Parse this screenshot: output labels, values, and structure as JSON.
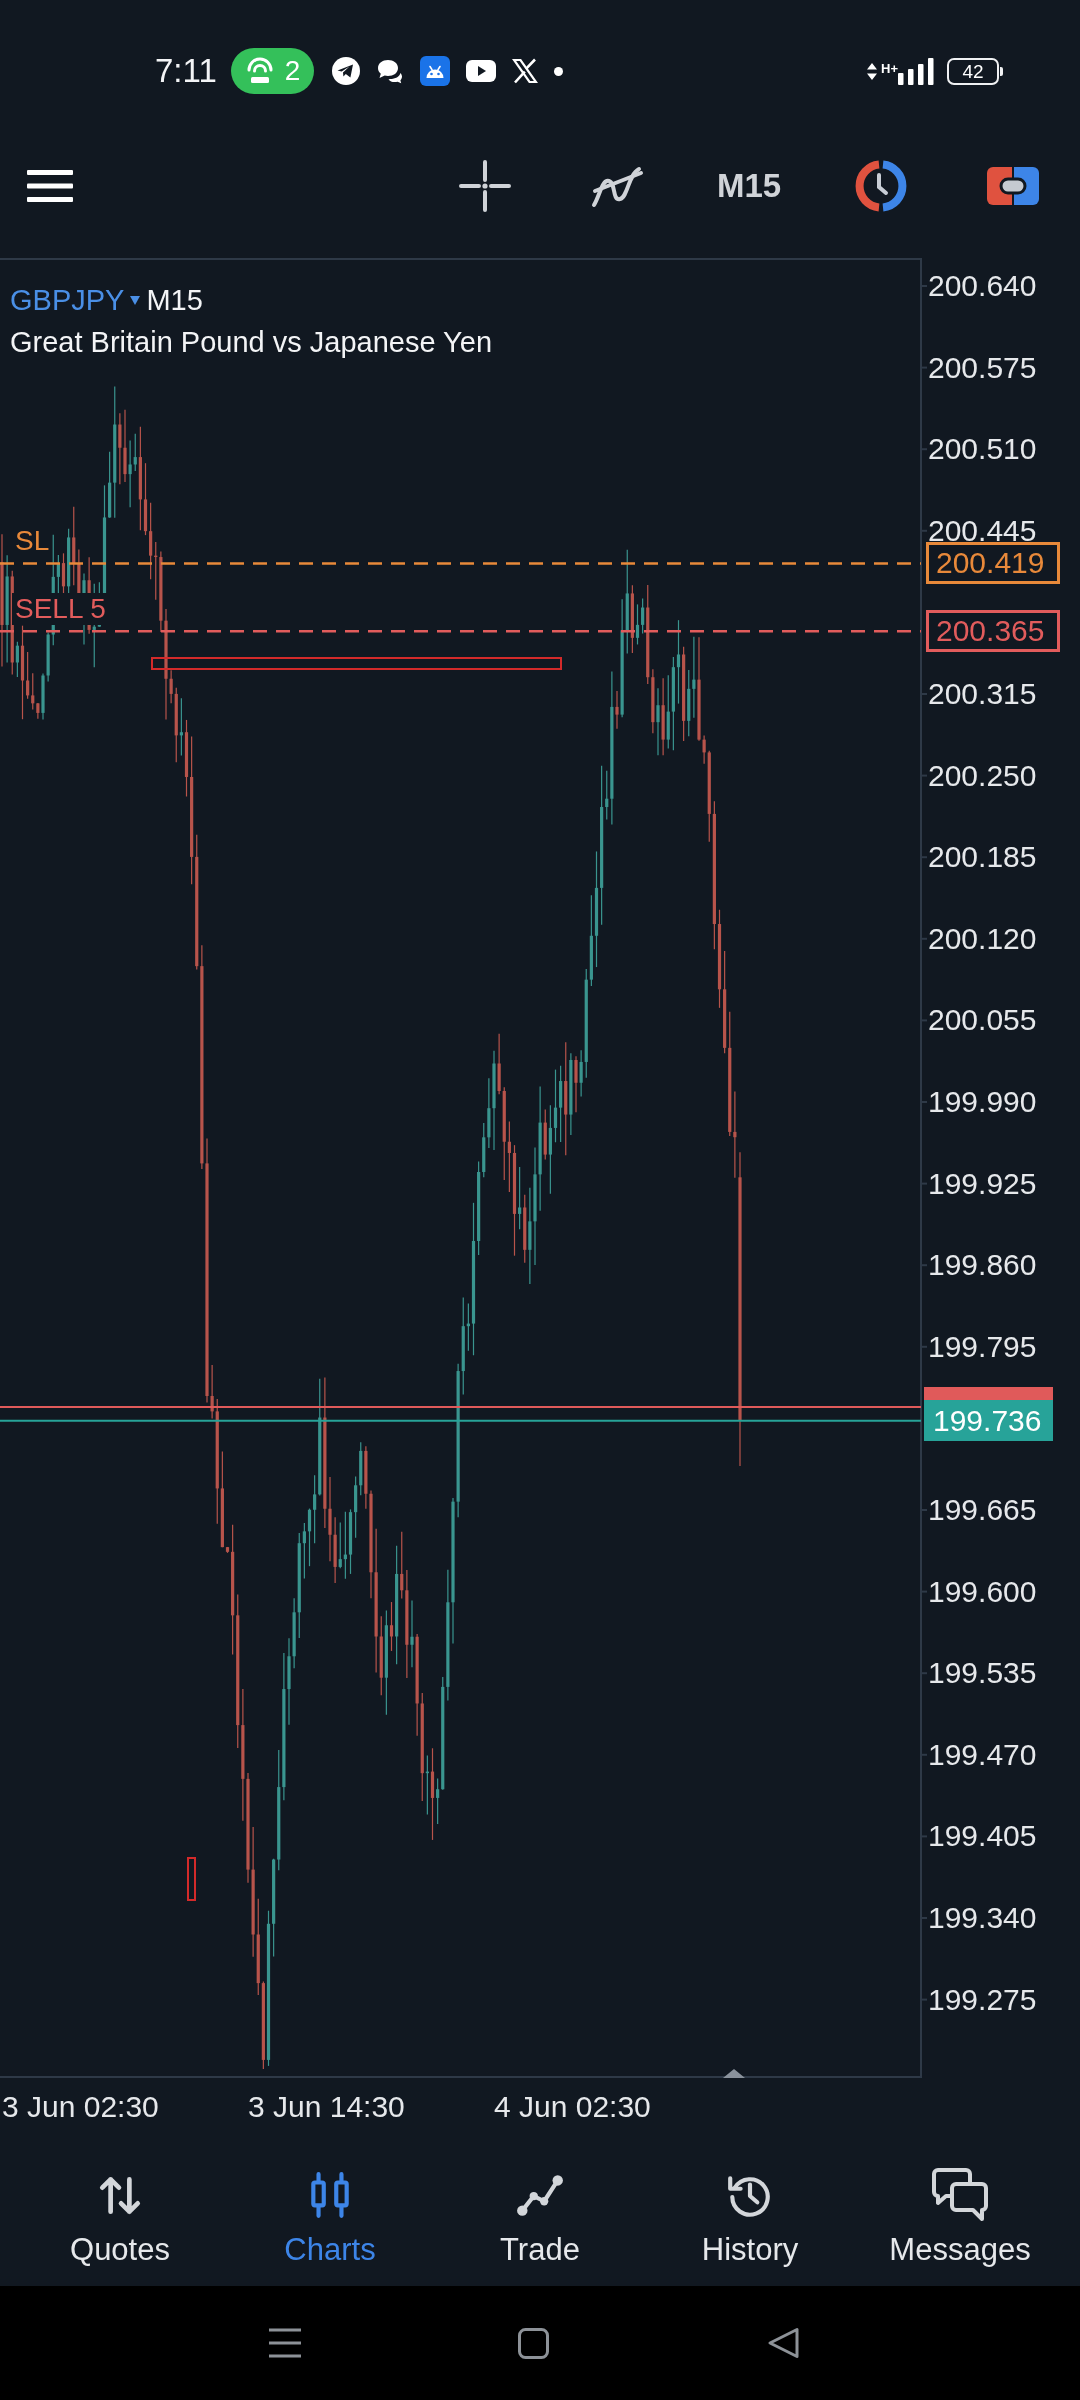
{
  "status_bar": {
    "time": "7:11",
    "hotspot_count": "2",
    "network_type": "H+",
    "battery": "42"
  },
  "toolbar": {
    "timeframe": "M15"
  },
  "chart": {
    "symbol": "GBPJPY",
    "timeframe": "M15",
    "description": "Great Britain Pound vs Japanese Yen",
    "order_lines": [
      {
        "label": "SL",
        "price": "200.419",
        "color": "#e8893a"
      },
      {
        "label": "SELL 5",
        "price": "200.365",
        "color": "#e25c5c"
      }
    ],
    "price_lines": [
      {
        "kind": "bid"
      },
      {
        "kind": "ask",
        "price": "199.736"
      }
    ],
    "price_scale": [
      "200.640",
      "200.575",
      "200.510",
      "200.445",
      "200.315",
      "200.250",
      "200.185",
      "200.120",
      "200.055",
      "199.990",
      "199.925",
      "199.860",
      "199.795",
      "199.665",
      "199.600",
      "199.535",
      "199.470",
      "199.405",
      "199.340",
      "199.275"
    ],
    "time_scale": [
      "3 Jun 02:30",
      "3 Jun 14:30",
      "4 Jun 02:30"
    ]
  },
  "bottom_nav": [
    {
      "label": "Quotes",
      "selected": false
    },
    {
      "label": "Charts",
      "selected": true
    },
    {
      "label": "Trade",
      "selected": false
    },
    {
      "label": "History",
      "selected": false
    },
    {
      "label": "Messages",
      "selected": false
    }
  ]
}
